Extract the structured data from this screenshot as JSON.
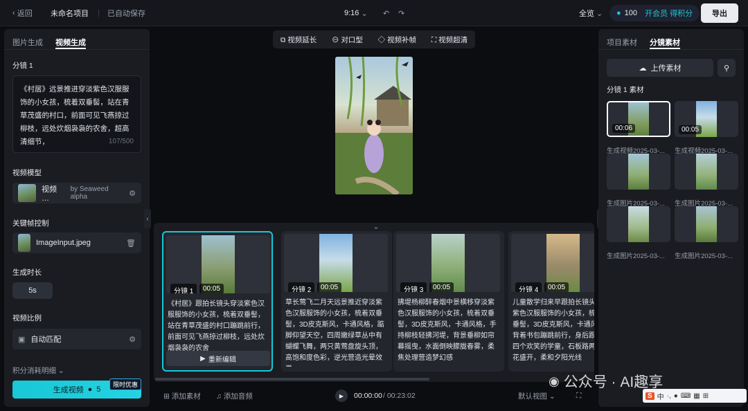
{
  "topbar": {
    "back": "返回",
    "project": "未命名项目",
    "saved": "已自动保存",
    "aspect": "9:16",
    "view": "全览",
    "credits": "100",
    "vip": "开会员 得积分",
    "export": "导出"
  },
  "left": {
    "tabs": [
      "图片生成",
      "视频生成"
    ],
    "shot_label": "分镜 1",
    "prompt": "《村居》远景推进穿淡紫色汉服服饰的小女孩，梳着双垂髻，站在青草茂盛的村口，前面可见飞燕掠过柳枝，远处炊烟袅袅的农舍，超高清细节，",
    "prompt_count": "107/500",
    "model_label": "视频模型",
    "model_name": "视频 …",
    "model_by": "by Seaweed alpha",
    "keyframe_label": "关键帧控制",
    "keyframe_file": "ImageInput.jpeg",
    "duration_label": "生成时长",
    "duration": "5s",
    "ratio_label": "视频比例",
    "ratio": "自动匹配",
    "cost_label": "积分消耗明细",
    "generate": "生成视频",
    "generate_cost": "5",
    "promo": "限时优惠"
  },
  "tools": [
    "视频延长",
    "对口型",
    "视频补帧",
    "视频超清"
  ],
  "shots": [
    {
      "tag": "分镜 1",
      "time": "00:05",
      "text": "《村居》跟拍长镜头穿淡紫色汉服服饰的小女孩，梳着双垂髻，站在青草茂盛的村口蹦跳前行，前面可见飞燕掠过柳枝，远处炊烟袅袅的农舍"
    },
    {
      "tag": "分镜 2",
      "time": "00:05",
      "text": "草长莺飞二月天远景推近穿淡紫色汉服服饰的小女孩，梳着双垂髻，3D皮克斯风，卡通风格，踮脚仰望天空，四周嫩绿草丛中有蝴蝶飞舞，两只黄莺盘旋头顶，高饱和度色彩，逆光营造光晕效果"
    },
    {
      "tag": "分镜 3",
      "time": "00:05",
      "text": "拂堤杨柳醉春烟中景横移穿淡紫色汉服服饰的小女孩，梳着双垂髻，3D皮克斯风，卡通风格，手持柳枝轻拂河堤，背景垂柳如帘幕摇曳，水面倒映朦胧春雾，柔焦处理营造梦幻感"
    },
    {
      "tag": "分镜 4",
      "time": "00:05",
      "text": "儿童散学归来早跟拍长镜头穿淡紫色汉服服饰的小女孩，梳着双垂髻，3D皮克斯风，卡通风格，背着书包蹦跳前行，身后跟随三四个欢笑的学童，石板路两侧野花盛开，柔和夕阳光线"
    }
  ],
  "reedit": "重新编辑",
  "bottom": {
    "add_material": "添加素材",
    "add_audio": "添加音频",
    "time_current": "00:00:00",
    "time_total": "/ 00:23:02",
    "view": "默认视图"
  },
  "right": {
    "tabs": [
      "项目素材",
      "分镜素材"
    ],
    "upload": "上传素材",
    "section": "分镜 1 素材",
    "items": [
      {
        "time": "00:06",
        "caption": "生成视频2025-03-..."
      },
      {
        "time": "00:05",
        "caption": "生成视频2025-03-..."
      },
      {
        "time": "",
        "caption": "生成图片2025-03-..."
      },
      {
        "time": "",
        "caption": "生成图片2025-03-..."
      },
      {
        "time": "",
        "caption": "生成图片2025-03-..."
      },
      {
        "time": "",
        "caption": "生成图片2025-03-..."
      }
    ]
  },
  "watermark": "公众号 · AI趣享",
  "ime": "中"
}
